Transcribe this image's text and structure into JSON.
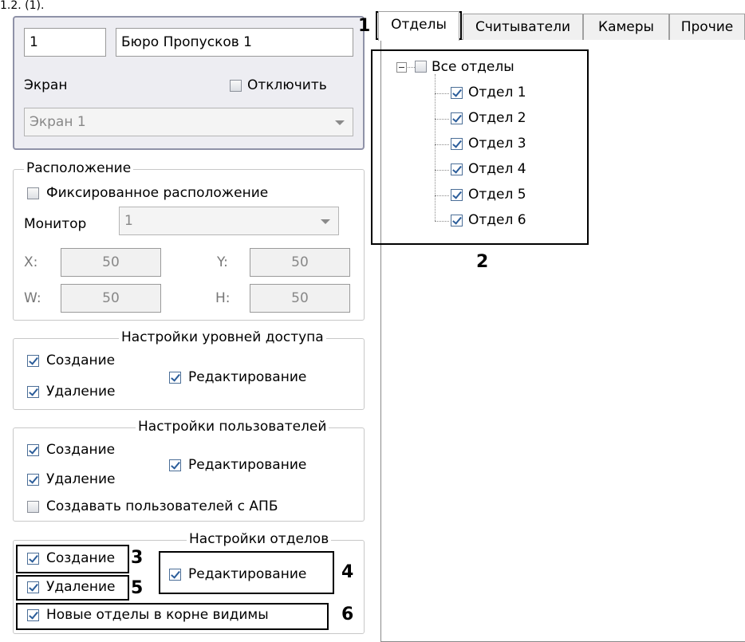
{
  "top_cut_text": "1.2. (1).",
  "device": {
    "id": "1",
    "name": "Бюро Пропусков 1",
    "screen_label": "Экран",
    "disable_label": "Отключить",
    "disable_checked": false,
    "screen_value": "Экран 1"
  },
  "location": {
    "title": "Расположение",
    "fixed_label": "Фиксированное расположение",
    "fixed_checked": false,
    "monitor_label": "Монитор",
    "monitor_value": "1",
    "x_label": "X:",
    "x_value": "50",
    "y_label": "Y:",
    "y_value": "50",
    "w_label": "W:",
    "w_value": "50",
    "h_label": "H:",
    "h_value": "50"
  },
  "access_levels": {
    "title": "Настройки уровней доступа",
    "create_label": "Создание",
    "delete_label": "Удаление",
    "edit_label": "Редактирование"
  },
  "users": {
    "title": "Настройки пользователей",
    "create_label": "Создание",
    "delete_label": "Удаление",
    "edit_label": "Редактирование",
    "apb_label": "Создавать пользователей с АПБ",
    "apb_checked": false
  },
  "departments": {
    "title": "Настройки отделов",
    "create_label": "Создание",
    "delete_label": "Удаление",
    "edit_label": "Редактирование",
    "root_visible_label": "Новые отделы в корне видимы"
  },
  "tabs": [
    {
      "label": "Отделы",
      "active": true
    },
    {
      "label": "Считыватели",
      "active": false
    },
    {
      "label": "Камеры",
      "active": false
    },
    {
      "label": "Прочие",
      "active": false
    }
  ],
  "tree": {
    "root_label": "Все отделы",
    "items": [
      "Отдел 1",
      "Отдел 2",
      "Отдел 3",
      "Отдел 4",
      "Отдел 5",
      "Отдел 6"
    ]
  },
  "callouts": {
    "n1": "1",
    "n2": "2",
    "n3": "3",
    "n4": "4",
    "n5": "5",
    "n6": "6"
  },
  "colors": {
    "card_bg": "#ededf2",
    "card_border": "#8f92a8",
    "check_color": "#2b5d9a",
    "highlight_border": "#000000"
  }
}
